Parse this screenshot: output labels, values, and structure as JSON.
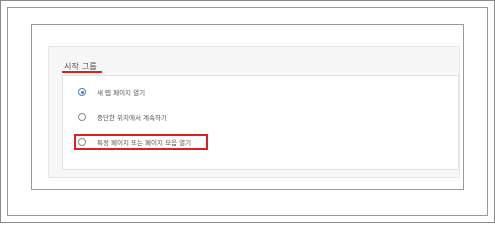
{
  "settings": {
    "section_title": "시작 그룹",
    "options": [
      {
        "label": "새 탭 페이지 열기",
        "selected": true
      },
      {
        "label": "중단한 위치에서 계속하기",
        "selected": false
      },
      {
        "label": "특정 페이지 또는 페이지 모음 열기",
        "selected": false
      }
    ]
  },
  "colors": {
    "highlight": "#e02020",
    "accent": "#4a80c8"
  }
}
